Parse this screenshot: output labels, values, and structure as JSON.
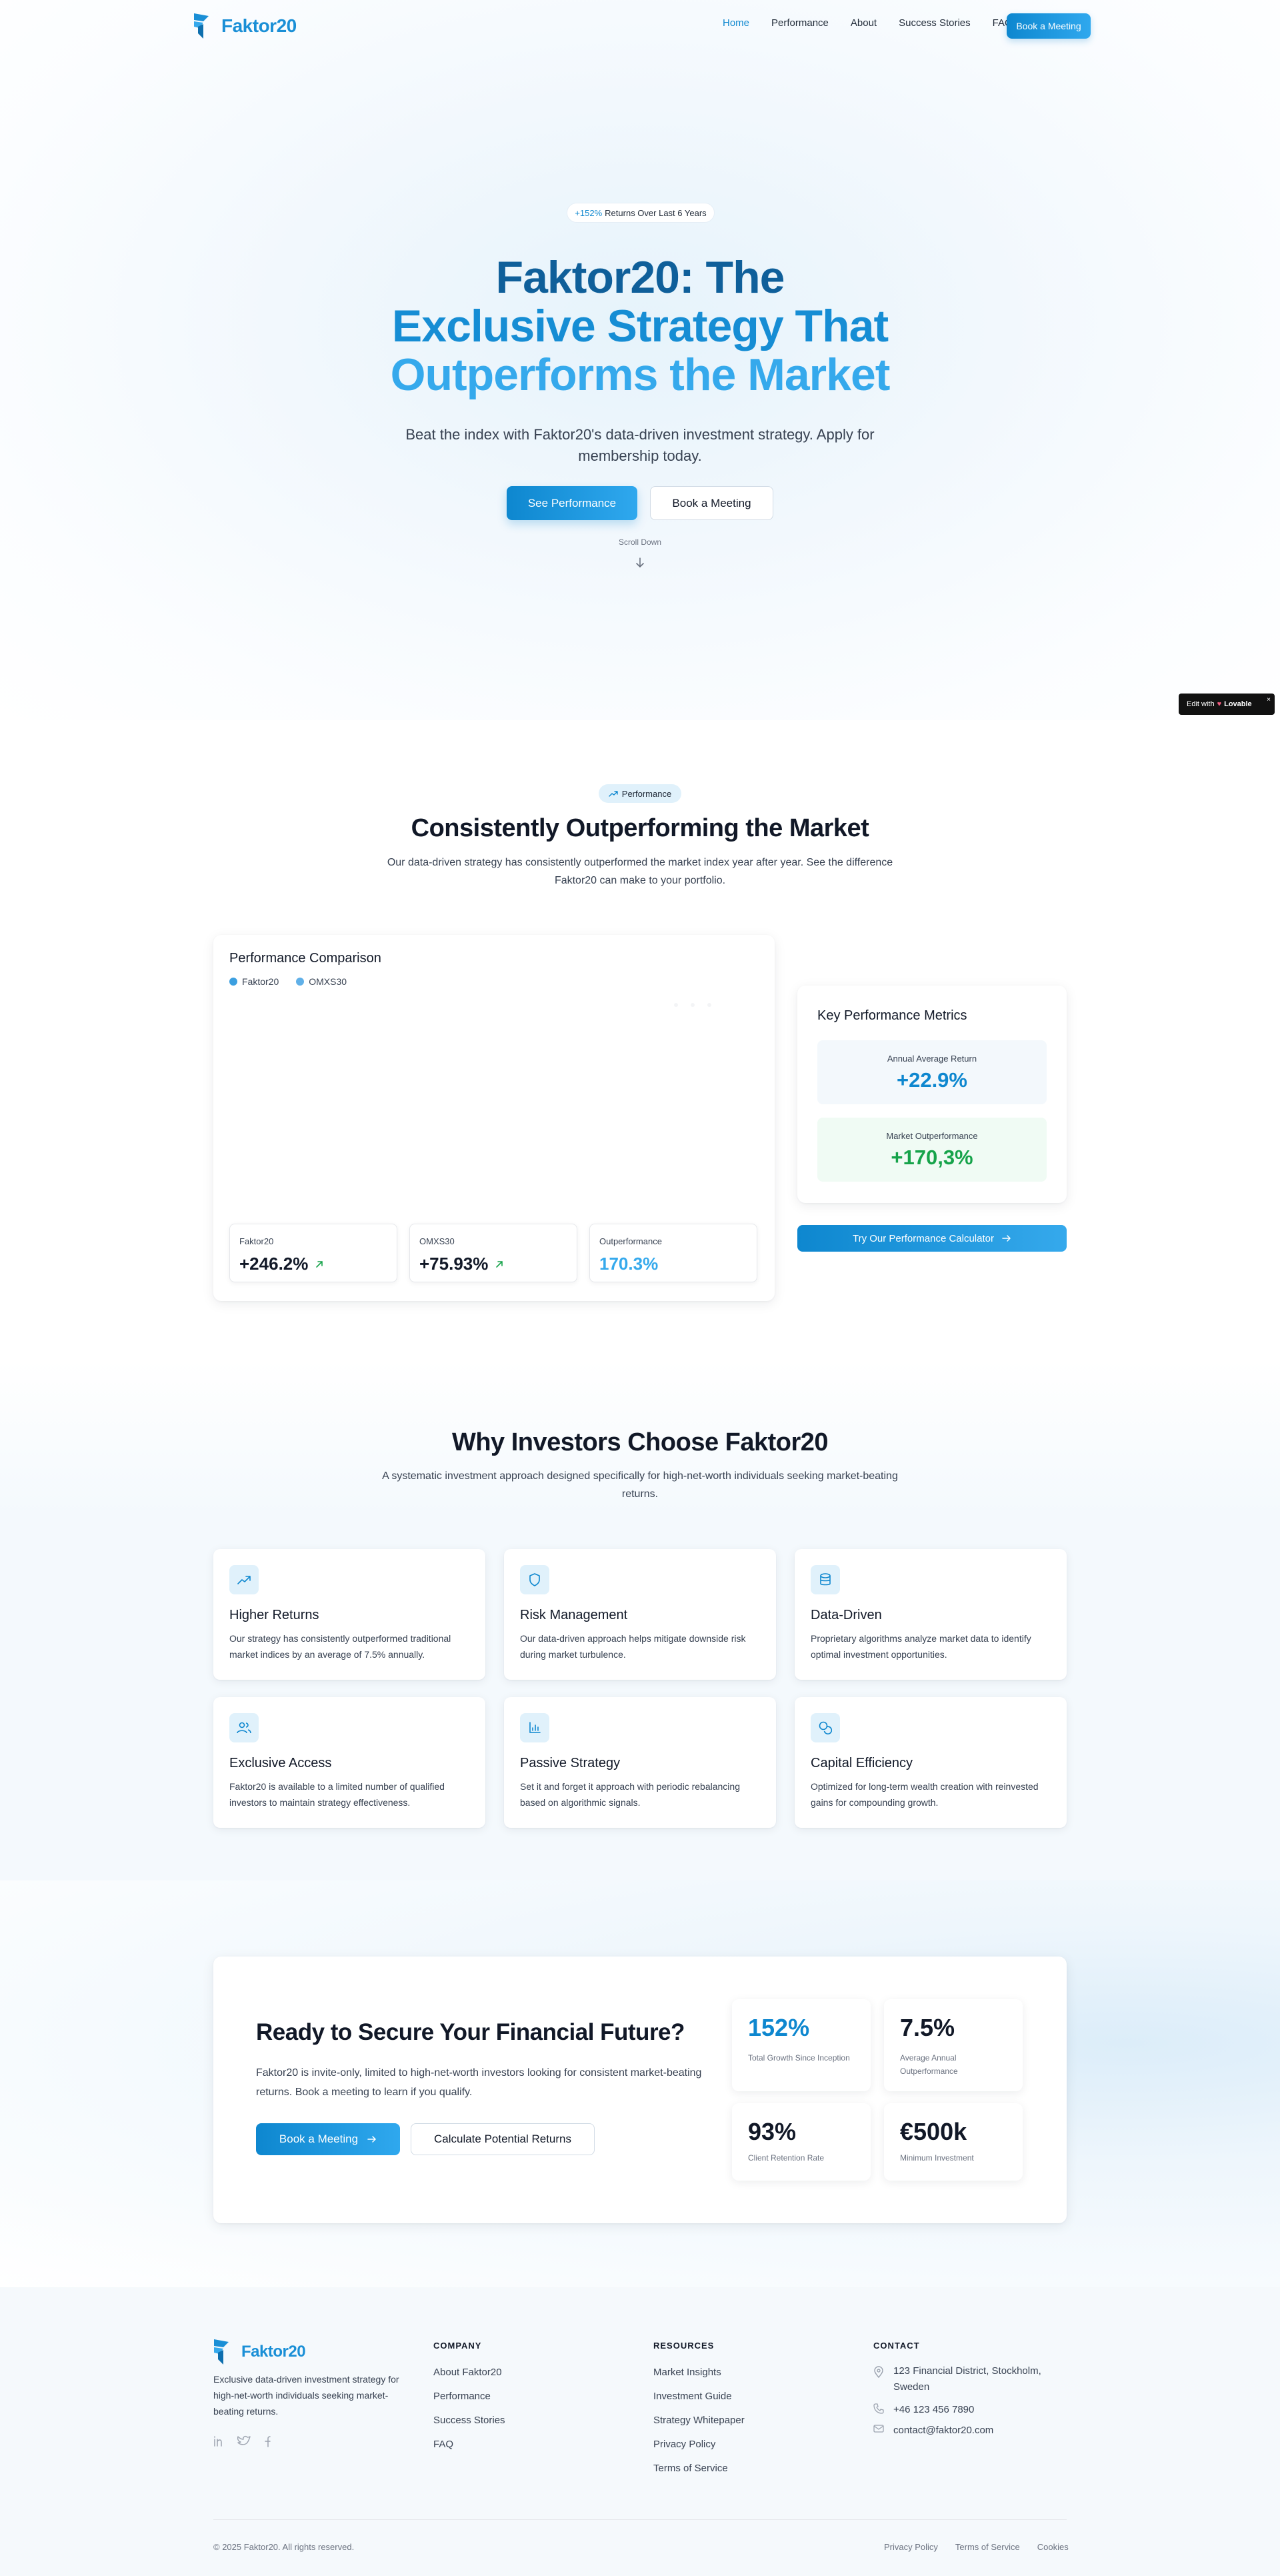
{
  "nav": {
    "logo_text": "Faktor20",
    "links": [
      {
        "label": "Home",
        "active": true
      },
      {
        "label": "Performance",
        "active": false
      },
      {
        "label": "About",
        "active": false
      },
      {
        "label": "Success Stories",
        "active": false
      },
      {
        "label": "FAQ",
        "active": false
      }
    ],
    "cta": "Book a Meeting"
  },
  "hero": {
    "pill_accent": "+152%",
    "pill_text": "Returns Over Last 6 Years",
    "title_line1": "Faktor20: The",
    "title_line2": "Exclusive Strategy That",
    "title_line3": "Outperforms the Market",
    "subtitle": "Beat the index with Faktor20's data-driven investment strategy. Apply for membership today.",
    "primary_button": "See Performance",
    "secondary_button": "Book a Meeting",
    "scroll_label": "Scroll Down"
  },
  "lovable_badge": {
    "prefix": "Edit with",
    "brand": "Lovable",
    "close": "×"
  },
  "performance": {
    "tag": "Performance",
    "title": "Consistently Outperforming the Market",
    "subtitle": "Our data-driven strategy has consistently outperformed the market index year after year. See the difference Faktor20 can make to your portfolio.",
    "chart": {
      "title": "Performance Comparison",
      "legend": [
        "Faktor20",
        "OMXS30"
      ]
    },
    "summary": [
      {
        "label": "Faktor20",
        "value": "+246.2%"
      },
      {
        "label": "OMXS30",
        "value": "+75.93%"
      },
      {
        "label": "Outperformance",
        "value": "170.3%"
      }
    ],
    "metrics": {
      "title": "Key Performance Metrics",
      "items": [
        {
          "label": "Annual Average Return",
          "value": "+22.9%",
          "color": "#0e87cf"
        },
        {
          "label": "Market Outperformance",
          "value": "+170,3%",
          "color": "#16a34a"
        }
      ]
    },
    "calc_button": "Try Our Performance Calculator"
  },
  "why": {
    "title": "Why Investors Choose Faktor20",
    "subtitle": "A systematic investment approach designed specifically for high-net-worth individuals seeking market-beating returns.",
    "features": [
      {
        "icon": "trending-up-icon",
        "title": "Higher Returns",
        "desc": "Our strategy has consistently outperformed traditional market indices by an average of 7.5% annually."
      },
      {
        "icon": "shield-icon",
        "title": "Risk Management",
        "desc": "Our data-driven approach helps mitigate downside risk during market turbulence."
      },
      {
        "icon": "database-icon",
        "title": "Data-Driven",
        "desc": "Proprietary algorithms analyze market data to identify optimal investment opportunities."
      },
      {
        "icon": "users-icon",
        "title": "Exclusive Access",
        "desc": "Faktor20 is available to a limited number of qualified investors to maintain strategy effectiveness."
      },
      {
        "icon": "bar-chart-icon",
        "title": "Passive Strategy",
        "desc": "Set it and forget it approach with periodic rebalancing based on algorithmic signals."
      },
      {
        "icon": "coins-icon",
        "title": "Capital Efficiency",
        "desc": "Optimized for long-term wealth creation with reinvested gains for compounding growth."
      }
    ]
  },
  "cta": {
    "title": "Ready to Secure Your Financial Future?",
    "desc": "Faktor20 is invite-only, limited to high-net-worth investors looking for consistent market-beating returns. Book a meeting to learn if you qualify.",
    "primary_button": "Book a Meeting",
    "secondary_button": "Calculate Potential Returns",
    "stats": [
      {
        "value": "152%",
        "caption": "Total Growth Since Inception",
        "color": "#0e87cf"
      },
      {
        "value": "7.5%",
        "caption": "Average Annual Outperformance",
        "color": "#111827"
      },
      {
        "value": "93%",
        "caption": "Client Retention Rate",
        "color": "#111827"
      },
      {
        "value": "€500k",
        "caption": "Minimum Investment",
        "color": "#111827"
      }
    ]
  },
  "footer": {
    "logo_text": "Faktor20",
    "desc": "Exclusive data-driven investment strategy for high-net-worth individuals seeking market-beating returns.",
    "company_title": "COMPANY",
    "company_links": [
      "About Faktor20",
      "Performance",
      "Success Stories",
      "FAQ"
    ],
    "resources_title": "RESOURCES",
    "resources_links": [
      "Market Insights",
      "Investment Guide",
      "Strategy Whitepaper",
      "Privacy Policy",
      "Terms of Service"
    ],
    "contact_title": "CONTACT",
    "address": "123 Financial District, Stockholm, Sweden",
    "phone": "+46 123 456 7890",
    "email": "contact@faktor20.com",
    "copyright": "© 2025 Faktor20. All rights reserved.",
    "bottom_links": [
      "Privacy Policy",
      "Terms of Service",
      "Cookies"
    ]
  },
  "colors": {
    "brand": "#0e87cf",
    "brand_light": "#35a9ec",
    "faktor20_series": "#3b9fe0",
    "omxs30_series": "#60b0e8",
    "green": "#16a34a"
  }
}
